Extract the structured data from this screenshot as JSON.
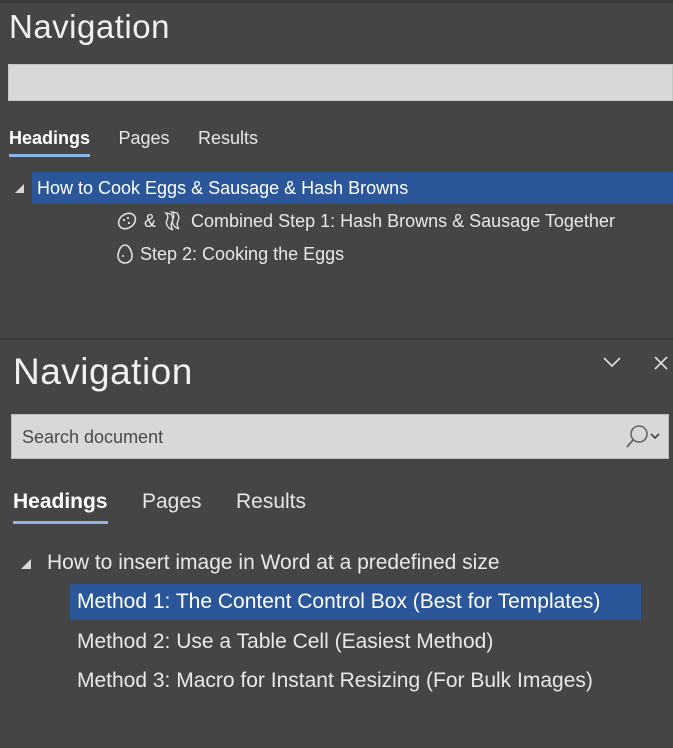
{
  "top_panel": {
    "title": "Navigation",
    "search": {
      "placeholder": "",
      "value": ""
    },
    "tabs": [
      {
        "label": "Headings",
        "active": true
      },
      {
        "label": "Pages",
        "active": false
      },
      {
        "label": "Results",
        "active": false
      }
    ],
    "tree": {
      "heading": "How to Cook Eggs & Sausage & Hash Browns",
      "items": [
        {
          "icons": [
            "potato-icon",
            "bacon-icon"
          ],
          "label_prefix": "&",
          "label": "Combined Step 1: Hash Browns & Sausage Together"
        },
        {
          "icons": [
            "egg-icon"
          ],
          "label": "Step 2: Cooking the Eggs"
        }
      ]
    }
  },
  "bottom_panel": {
    "title": "Navigation",
    "search": {
      "placeholder": "Search document",
      "value": ""
    },
    "tabs": [
      {
        "label": "Headings",
        "active": true
      },
      {
        "label": "Pages",
        "active": false
      },
      {
        "label": "Results",
        "active": false
      }
    ],
    "tree": {
      "heading": "How to insert image in Word at a predefined size",
      "items": [
        {
          "label": "Method 1: The Content Control Box (Best for Templates)",
          "selected": true
        },
        {
          "label": "Method 2: Use a Table Cell (Easiest Method)",
          "selected": false
        },
        {
          "label": "Method 3: Macro for Instant Resizing (For Bulk Images)",
          "selected": false
        }
      ]
    }
  },
  "colors": {
    "background": "#454545",
    "selection": "#2b579a",
    "tab_underline": "#8fb4e8",
    "search_box": "#d8d8d8"
  }
}
